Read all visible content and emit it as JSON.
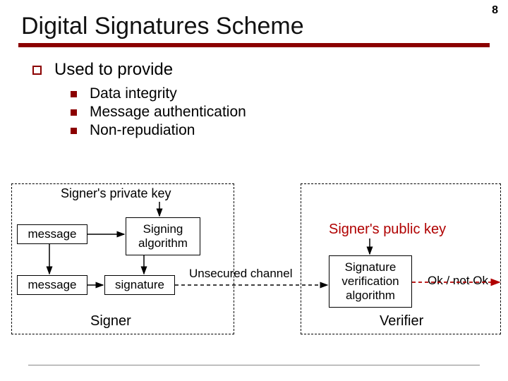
{
  "page_number": "8",
  "title": "Digital Signatures Scheme",
  "list": {
    "heading": "Used to provide",
    "items": [
      "Data integrity",
      "Message authentication",
      "Non-repudiation"
    ]
  },
  "diagram": {
    "signer_private_key": "Signer's private key",
    "signer_public_key": "Signer's public key",
    "message_top": "message",
    "message_bottom": "message",
    "signing_l1": "Signing",
    "signing_l2": "algorithm",
    "signature": "signature",
    "channel": "Unsecured channel",
    "verify_l1": "Signature",
    "verify_l2": "verification",
    "verify_l3": "algorithm",
    "result": "Ok / not Ok",
    "role_signer": "Signer",
    "role_verifier": "Verifier"
  }
}
